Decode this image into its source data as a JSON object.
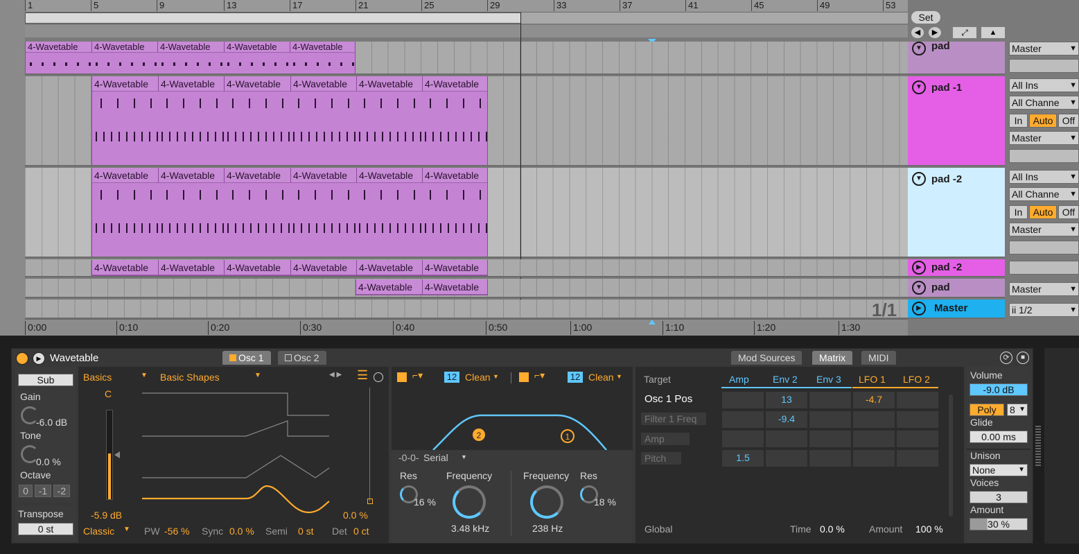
{
  "ruler": {
    "bars": [
      "1",
      "5",
      "9",
      "13",
      "17",
      "21",
      "25",
      "29",
      "33",
      "37",
      "41",
      "45",
      "49",
      "53"
    ]
  },
  "set": {
    "label": "Set"
  },
  "clip_name": "4-Wavetable",
  "tracks": [
    {
      "name": "pad",
      "out": "Master"
    },
    {
      "name": "pad -1",
      "in": "All Ins",
      "channel": "All Channe",
      "in_btn": "In",
      "auto_btn": "Auto",
      "off_btn": "Off",
      "out": "Master"
    },
    {
      "name": "pad -2",
      "in": "All Ins",
      "channel": "All Channe",
      "in_btn": "In",
      "auto_btn": "Auto",
      "off_btn": "Off",
      "out": "Master"
    },
    {
      "name": "pad -2"
    },
    {
      "name": "pad",
      "out": "Master"
    },
    {
      "name": "Master",
      "out": "ii 1/2"
    }
  ],
  "page_count": "1/1",
  "time_ruler": [
    "0:00",
    "0:10",
    "0:20",
    "0:30",
    "0:40",
    "0:50",
    "1:00",
    "1:10",
    "1:20",
    "1:30"
  ],
  "device": {
    "name": "Wavetable",
    "tabs": [
      "Osc 1",
      "Osc 2"
    ],
    "right_tabs": [
      "Mod Sources",
      "Matrix",
      "MIDI"
    ],
    "sub": {
      "title": "Sub",
      "gain_label": "Gain",
      "gain": "-6.0 dB",
      "tone_label": "Tone",
      "tone": "0.0 %",
      "octave_label": "Octave",
      "octaves": [
        "0",
        "-1",
        "-2"
      ],
      "transpose_label": "Transpose",
      "transpose": "0 st"
    },
    "osc": {
      "category": "Basics",
      "wavetable": "Basic Shapes",
      "note": "C",
      "level": "-5.9 dB",
      "mode": "Classic",
      "pw_label": "PW",
      "pw": "-56 %",
      "sync_label": "Sync",
      "sync": "0.0 %",
      "semi_label": "Semi",
      "semi": "0 st",
      "det_label": "Det",
      "det": "0 ct",
      "pos": "0.0 %"
    },
    "filter": {
      "slope1": "12",
      "type1": "Clean",
      "slope2": "12",
      "type2": "Clean",
      "routing": "Serial",
      "res1_label": "Res",
      "res1": "16 %",
      "freq1_label": "Frequency",
      "freq1": "3.48 kHz",
      "freq2_label": "Frequency",
      "freq2": "238 Hz",
      "res2_label": "Res",
      "res2": "18 %"
    },
    "matrix": {
      "target_label": "Target",
      "sources": [
        "Amp",
        "Env 2",
        "Env 3",
        "LFO 1",
        "LFO 2"
      ],
      "rows": [
        "Osc 1 Pos",
        "Filter 1 Freq",
        "Amp",
        "Pitch"
      ],
      "values": {
        "r0_env2": "13",
        "r0_lfo1": "-4.7",
        "r1_env2": "-9.4",
        "r3_amp": "1.5"
      },
      "global_label": "Global",
      "time_label": "Time",
      "time": "0.0 %",
      "amount_label": "Amount",
      "amount": "100 %"
    },
    "global": {
      "volume_label": "Volume",
      "volume": "-9.0 dB",
      "poly": "Poly",
      "voices_n": "8",
      "glide_label": "Glide",
      "glide": "0.00 ms",
      "unison_label": "Unison",
      "unison": "None",
      "voices_label": "Voices",
      "voices": "3",
      "amount_label": "Amount",
      "amount": "30 %"
    }
  },
  "colors": {
    "clip": "#c583d4",
    "accent": "#ffab2e",
    "blue": "#5fc8ff",
    "master": "#1eb0ef"
  }
}
